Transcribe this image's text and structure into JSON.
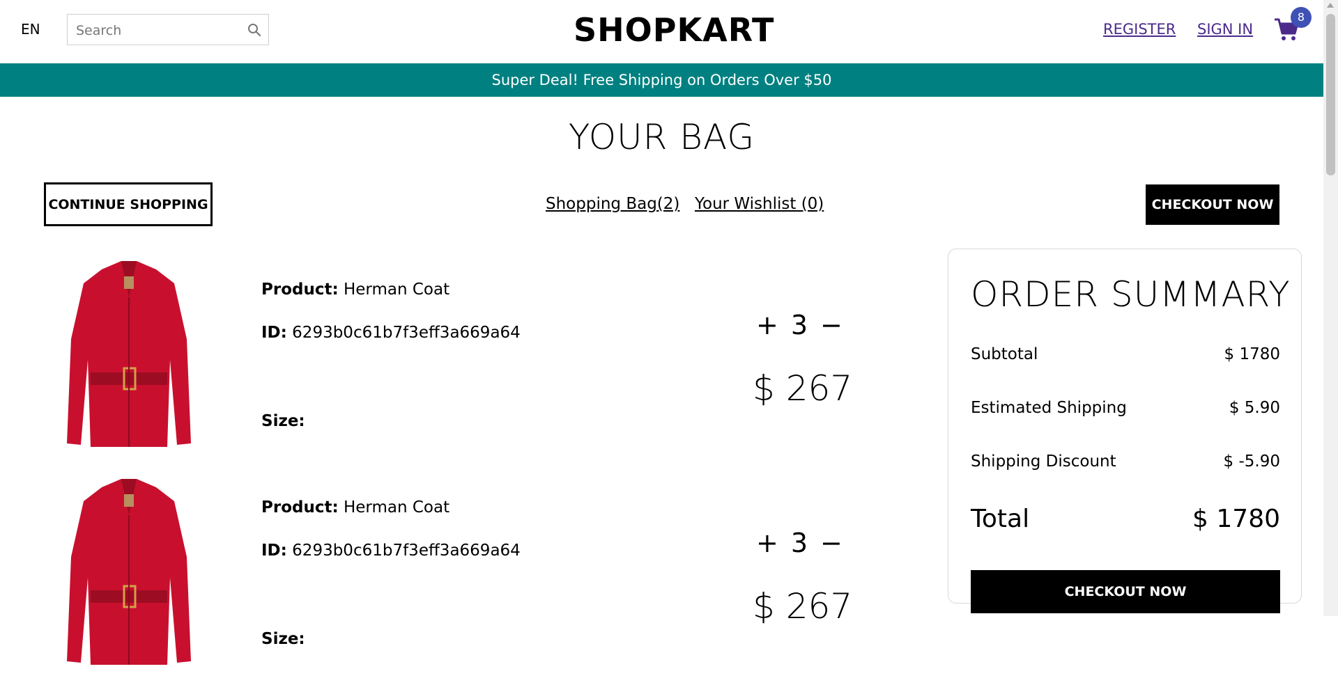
{
  "nav": {
    "language": "EN",
    "search_placeholder": "Search",
    "logo": "SHOPKART",
    "register": "REGISTER",
    "sign_in": "SIGN IN",
    "cart_count": "8"
  },
  "announcement": "Super Deal! Free Shipping on Orders Over $50",
  "page": {
    "title": "YOUR BAG",
    "continue_shopping": "CONTINUE SHOPPING",
    "shopping_bag": "Shopping Bag(2)",
    "wishlist": "Your Wishlist (0)",
    "checkout_top": "CHECKOUT NOW"
  },
  "products": [
    {
      "product_label": "Product:",
      "product_name": "Herman Coat",
      "id_label": "ID:",
      "id_value": "6293b0c61b7f3eff3a669a64",
      "size_label": "Size:",
      "plus": "+",
      "quantity": "3",
      "minus": "−",
      "price": "$ 267"
    },
    {
      "product_label": "Product:",
      "product_name": "Herman Coat",
      "id_label": "ID:",
      "id_value": "6293b0c61b7f3eff3a669a64",
      "size_label": "Size:",
      "plus": "+",
      "quantity": "3",
      "minus": "−",
      "price": "$ 267"
    }
  ],
  "summary": {
    "title": "ORDER SUMMARY",
    "subtotal_label": "Subtotal",
    "subtotal_value": "$ 1780",
    "shipping_label": "Estimated Shipping",
    "shipping_value": "$ 5.90",
    "discount_label": "Shipping Discount",
    "discount_value": "$ -5.90",
    "total_label": "Total",
    "total_value": "$ 1780",
    "checkout": "CHECKOUT NOW"
  },
  "colors": {
    "accent": "#008080",
    "link": "#4b2a8c",
    "badge": "#3f51b5",
    "coat": "#c8102e"
  }
}
